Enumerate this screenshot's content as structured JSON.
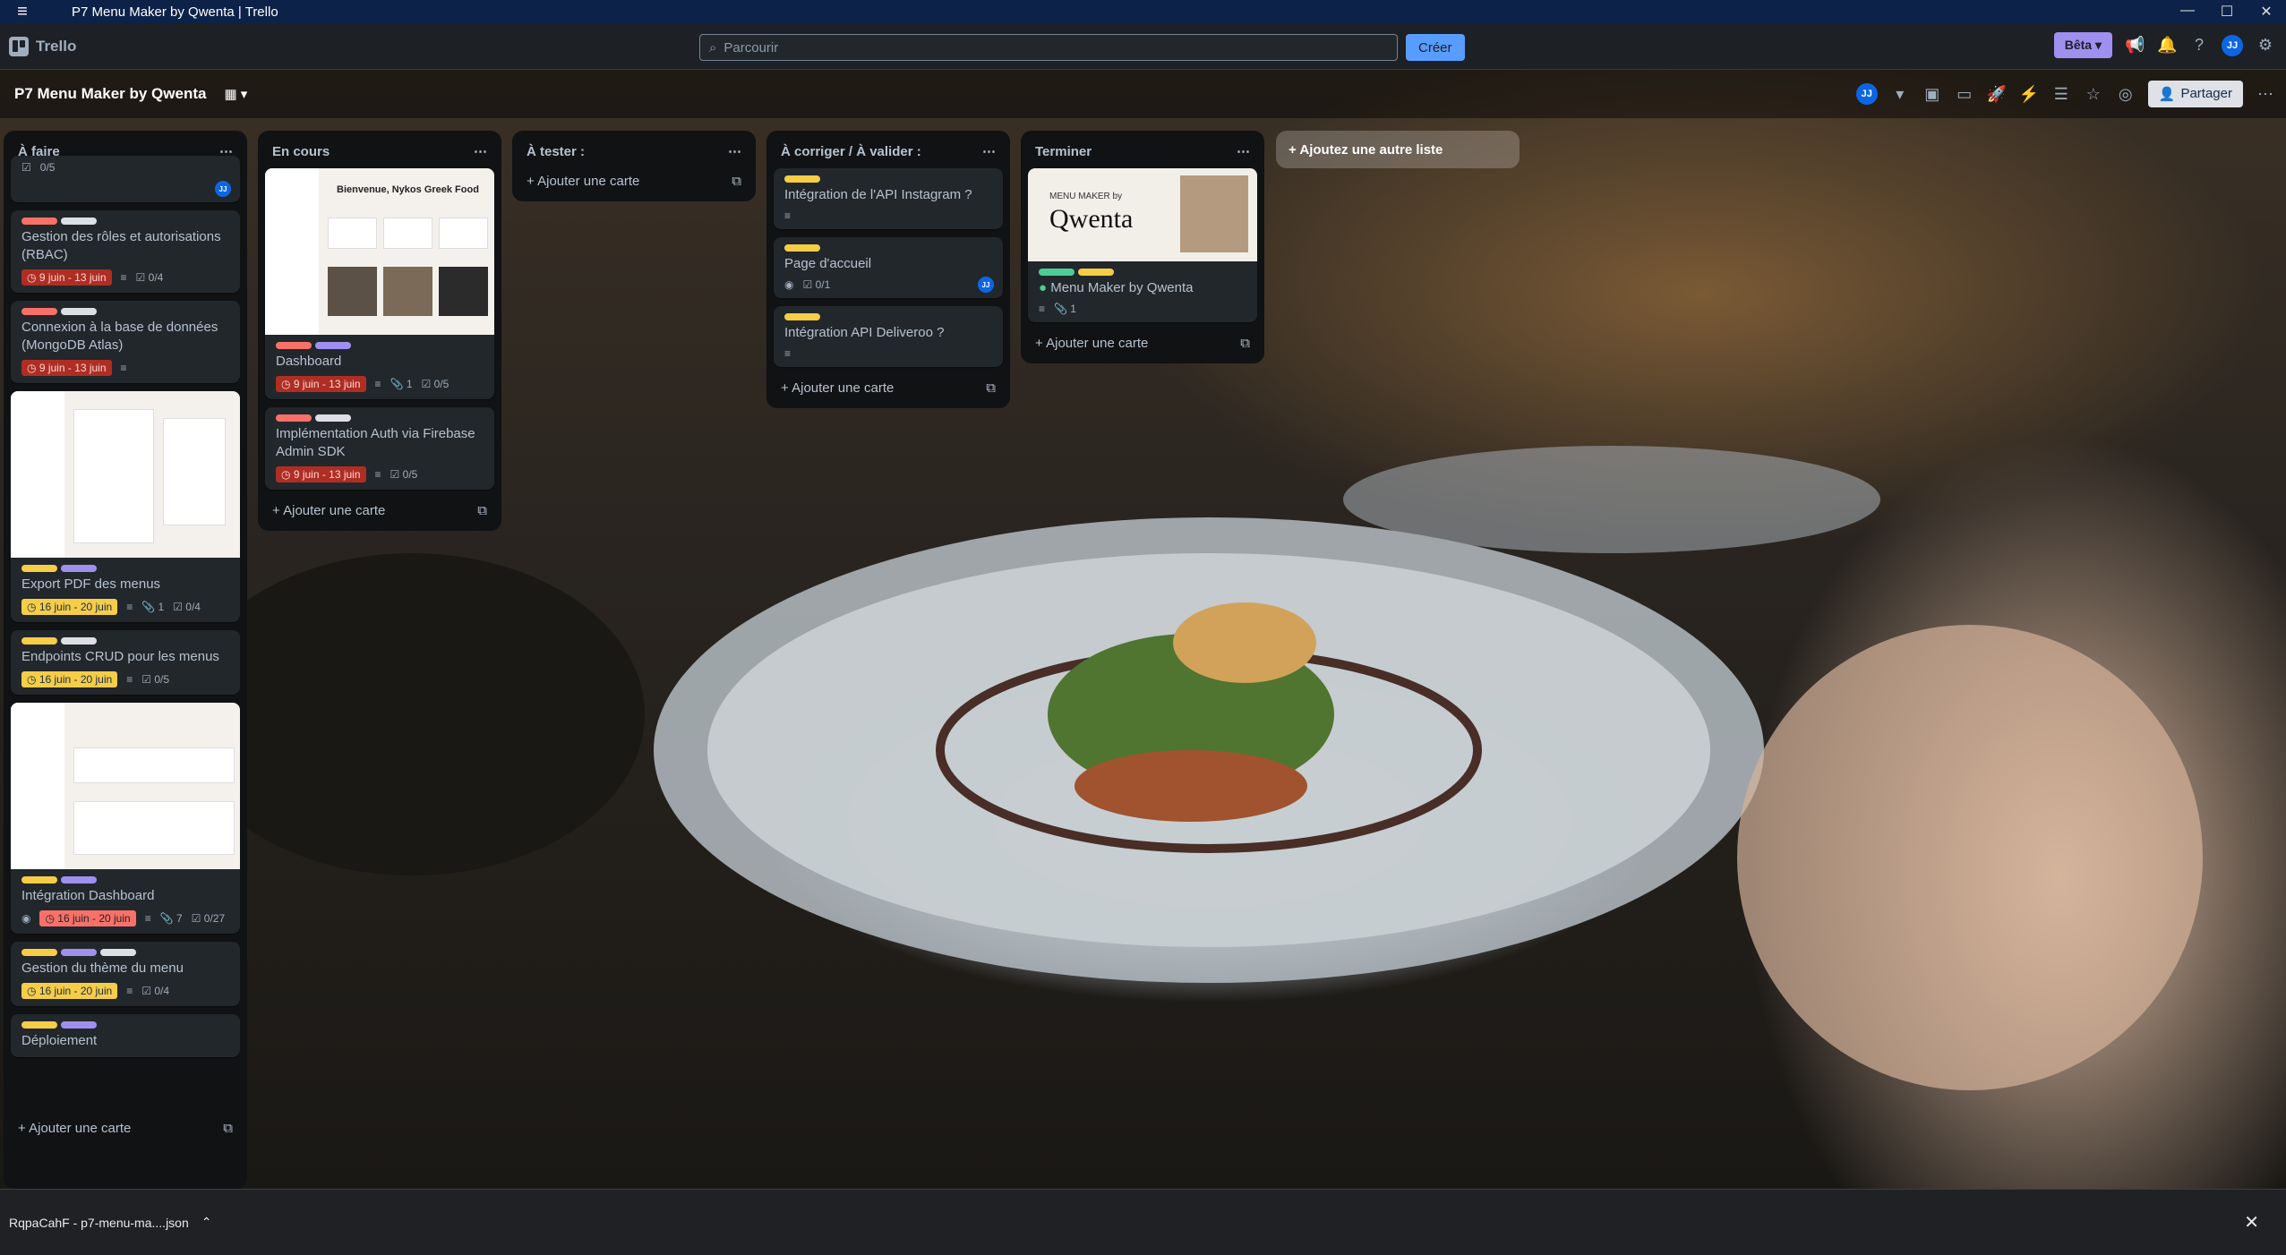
{
  "window": {
    "title": "P7 Menu Maker by Qwenta | Trello"
  },
  "topbar": {
    "logo": "Trello",
    "search_placeholder": "Parcourir",
    "create_label": "Créer",
    "beta_label": "Bêta"
  },
  "board": {
    "title": "P7 Menu Maker by Qwenta",
    "share_label": "Partager",
    "add_list_label": "+ Ajoutez une autre liste"
  },
  "lists": [
    {
      "title": "À faire",
      "add_label": "Ajouter une carte",
      "cards": [
        {
          "partial": "0/5"
        },
        {
          "title": "Gestion des rôles et autorisations (RBAC)",
          "date": "9 juin - 13 juin",
          "checklist": "0/4"
        },
        {
          "title": "Connexion à la base de données (MongoDB Atlas)",
          "date": "9 juin - 13 juin"
        },
        {
          "title": "Export PDF des menus",
          "date": "16 juin - 20 juin",
          "attachments": "1",
          "checklist": "0/4"
        },
        {
          "title": "Endpoints CRUD pour les menus",
          "date": "16 juin - 20 juin",
          "checklist": "0/5"
        },
        {
          "title": "Intégration Dashboard",
          "date": "16 juin - 20 juin",
          "attachments": "7",
          "checklist": "0/27"
        },
        {
          "title": "Gestion du thème du menu",
          "date": "16 juin - 20 juin",
          "checklist": "0/4"
        },
        {
          "title": "Déploiement"
        }
      ]
    },
    {
      "title": "En cours",
      "add_label": "Ajouter une carte",
      "cards": [
        {
          "title": "Dashboard",
          "date": "9 juin - 13 juin",
          "attachments": "1",
          "checklist": "0/5",
          "cover_heading": "Bienvenue, Nykos Greek Food"
        },
        {
          "title": "Implémentation Auth via Firebase Admin SDK",
          "date": "9 juin - 13 juin",
          "checklist": "0/5"
        }
      ]
    },
    {
      "title": "À tester :",
      "add_label": "Ajouter une carte",
      "cards": []
    },
    {
      "title": "À corriger / À valider :",
      "add_label": "Ajouter une carte",
      "cards": [
        {
          "title": "Intégration de l'API Instagram ?"
        },
        {
          "title": "Page d'accueil",
          "checklist": "0/1"
        },
        {
          "title": "Intégration API Deliveroo ?"
        }
      ]
    },
    {
      "title": "Terminer",
      "add_label": "Ajouter une carte",
      "cards": [
        {
          "title": "Menu Maker by Qwenta",
          "attachments": "1",
          "cover_small": "MENU MAKER by",
          "cover_brand": "Qwenta"
        }
      ]
    }
  ],
  "download": {
    "file": "RqpaCahF - p7-menu-ma....json"
  },
  "colors": {
    "red": "#f87168",
    "yellow": "#f5cd47",
    "purple": "#9f8fef",
    "green": "#4bce97",
    "blue": "#579dff",
    "gray": "#dcdfe4"
  }
}
